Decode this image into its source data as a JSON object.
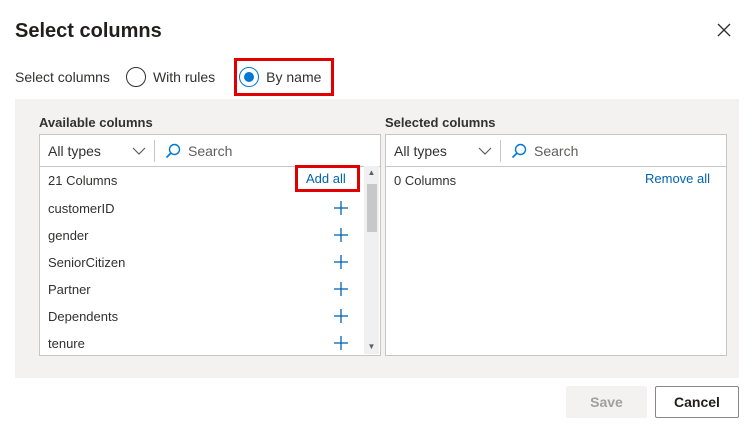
{
  "dialog": {
    "title": "Select columns"
  },
  "mode": {
    "label": "Select columns",
    "options": [
      {
        "label": "With rules",
        "selected": false
      },
      {
        "label": "By name",
        "selected": true
      }
    ]
  },
  "available": {
    "heading": "Available columns",
    "type_filter": "All types",
    "search_placeholder": "Search",
    "count_text": "21 Columns",
    "add_all_label": "Add all",
    "items": [
      "customerID",
      "gender",
      "SeniorCitizen",
      "Partner",
      "Dependents",
      "tenure"
    ]
  },
  "selected": {
    "heading": "Selected columns",
    "type_filter": "All types",
    "search_placeholder": "Search",
    "count_text": "0 Columns",
    "remove_all_label": "Remove all"
  },
  "footer": {
    "save_label": "Save",
    "cancel_label": "Cancel"
  },
  "colors": {
    "accent": "#0078d4",
    "highlight": "#e00000",
    "link": "#0063b1",
    "panel_bg": "#f3f2f1"
  }
}
